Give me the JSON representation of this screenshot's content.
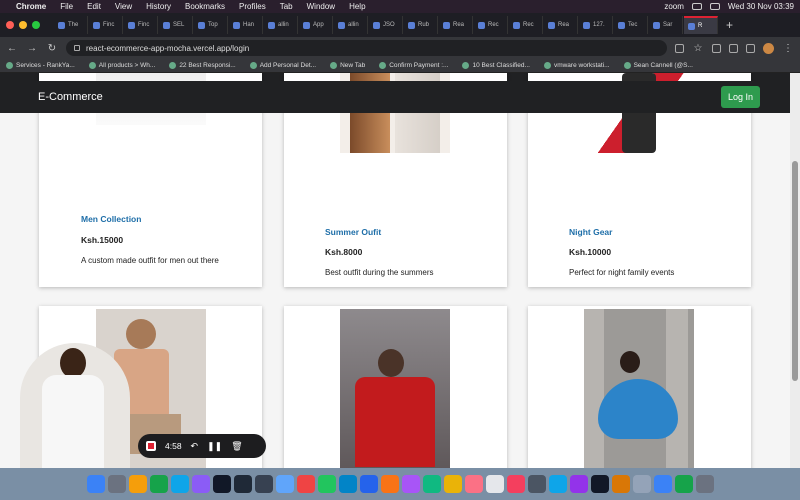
{
  "menubar": {
    "app_name": "Chrome",
    "items": [
      "File",
      "Edit",
      "View",
      "History",
      "Bookmarks",
      "Profiles",
      "Tab",
      "Window",
      "Help"
    ],
    "zoom_label": "zoom",
    "datetime": "Wed 30 Nov  03:39"
  },
  "tabs": [
    {
      "label": "The",
      "active": false
    },
    {
      "label": "Finc",
      "active": false
    },
    {
      "label": "Finc",
      "active": false
    },
    {
      "label": "SEL",
      "active": false
    },
    {
      "label": "Top",
      "active": false
    },
    {
      "label": "Han",
      "active": false
    },
    {
      "label": "allin",
      "active": false
    },
    {
      "label": "App",
      "active": false
    },
    {
      "label": "allin",
      "active": false
    },
    {
      "label": "JSO",
      "active": false
    },
    {
      "label": "Rub",
      "active": false
    },
    {
      "label": "Rea",
      "active": false
    },
    {
      "label": "Rec",
      "active": false
    },
    {
      "label": "Rec",
      "active": false
    },
    {
      "label": "Rea",
      "active": false
    },
    {
      "label": "127.",
      "active": false
    },
    {
      "label": "Tec",
      "active": false
    },
    {
      "label": "Sar",
      "active": false
    },
    {
      "label": "R",
      "active": true
    }
  ],
  "address": {
    "url": "react-ecommerce-app-mocha.vercel.app/login"
  },
  "bookmarks": [
    "Services - RankYa...",
    "All products > Wh...",
    "22 Best Responsi...",
    "Add Personal Det...",
    "New Tab",
    "Confirm Payment :...",
    "10 Best Classified...",
    "vmware workstati...",
    "Sean Cannell (@S..."
  ],
  "app": {
    "brand": "E-Commerce",
    "login_label": "Log In"
  },
  "products_row1": [
    {
      "title": "Men Collection",
      "price": "Ksh.15000",
      "desc": "A custom made outfit for men out there"
    },
    {
      "title": "Summer Oufit",
      "price": "Ksh.8000",
      "desc": "Best outfit during the summers"
    },
    {
      "title": "Night Gear",
      "price": "Ksh.10000",
      "desc": "Perfect for night family events"
    }
  ],
  "recorder": {
    "time": "4:58"
  },
  "colors": {
    "accent_link": "#1e6ea8",
    "login_green": "#2e9b4e",
    "appbar": "#202123"
  }
}
